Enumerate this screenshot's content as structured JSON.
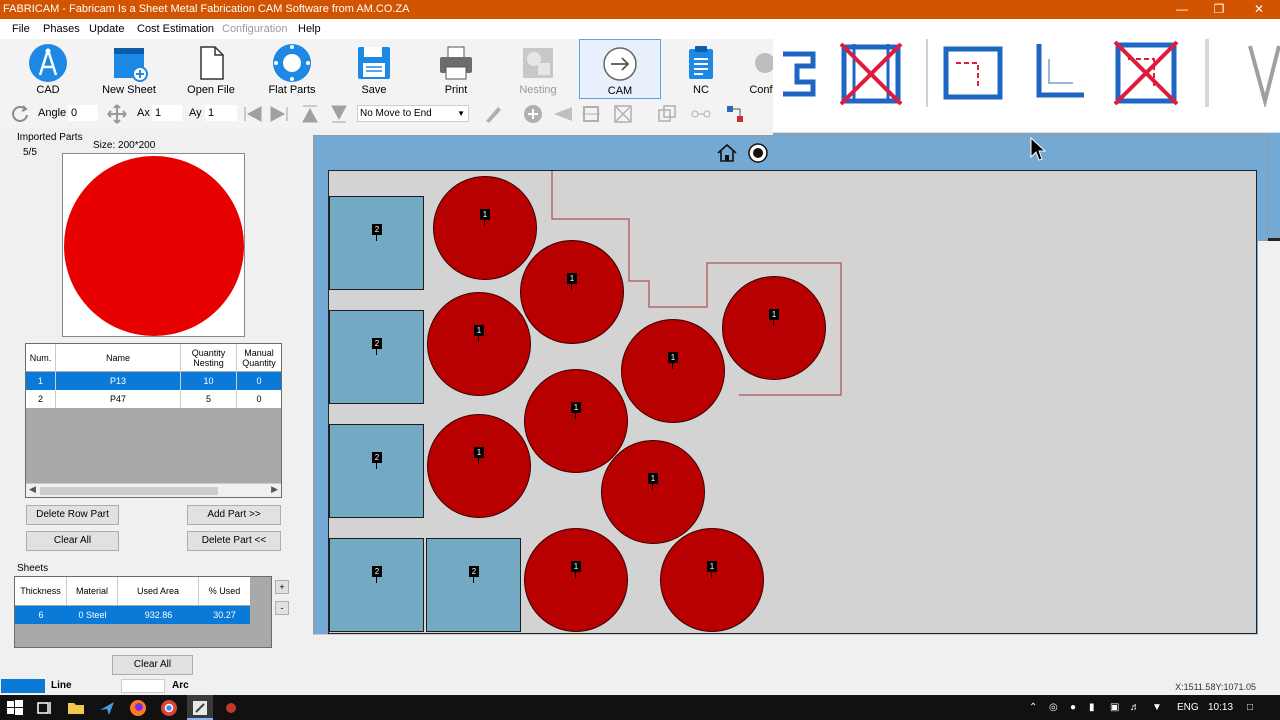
{
  "window": {
    "title": "FABRICAM - Fabricam Is a Sheet Metal Fabrication CAM Software from AM.CO.ZA"
  },
  "menu": [
    "File",
    "Phases",
    "Update",
    "Cost Estimation",
    "Configuration",
    "Help"
  ],
  "ribbon": {
    "cad": "CAD",
    "new_sheet": "New Sheet",
    "open_file": "Open File",
    "flat_parts": "Flat Parts",
    "save": "Save",
    "print": "Print",
    "nesting": "Nesting",
    "cam": "CAM",
    "nc": "NC",
    "config": "Confi"
  },
  "toolbar2": {
    "angle_label": "Angle",
    "angle_value": "0",
    "ax_label": "Ax",
    "ax_value": "1",
    "ay_label": "Ay",
    "ay_value": "1",
    "move_select": "No Move to End"
  },
  "parts_panel": {
    "title": "Imported Parts",
    "count": "5/5",
    "size": "Size: 200*200",
    "headers": [
      "Num.",
      "Name",
      "Quantity Nesting",
      "Manual Quantity"
    ],
    "rows": [
      {
        "num": "1",
        "name": "P13",
        "qty": "10",
        "manual": "0"
      },
      {
        "num": "2",
        "name": "P47",
        "qty": "5",
        "manual": "0"
      }
    ],
    "delete_row": "Delete Row Part",
    "add_part": "Add Part >>",
    "clear_all": "Clear All",
    "delete_part": "Delete Part <<"
  },
  "sheets_panel": {
    "title": "Sheets",
    "headers": [
      "Thickness",
      "Material",
      "Used Area",
      "% Used"
    ],
    "row": {
      "thickness": "6",
      "material": "0  Steel",
      "area": "932.86",
      "used": "30.27"
    },
    "clear_all": "Clear All",
    "plus": "+",
    "minus": "-"
  },
  "nest": {
    "rect_label": "2",
    "circle_label": "1"
  },
  "status": {
    "line": "Line",
    "arc": "Arc",
    "coords": "X:1511.58Y:1071.05",
    "line_color": "#0a79d8"
  },
  "taskbar": {
    "lang": "ENG",
    "time": "10:13"
  },
  "colors": {
    "title_bar": "#d35400",
    "part_circle": "#b80000",
    "part_rect": "#74a9c3",
    "selection": "#0a79d8"
  }
}
